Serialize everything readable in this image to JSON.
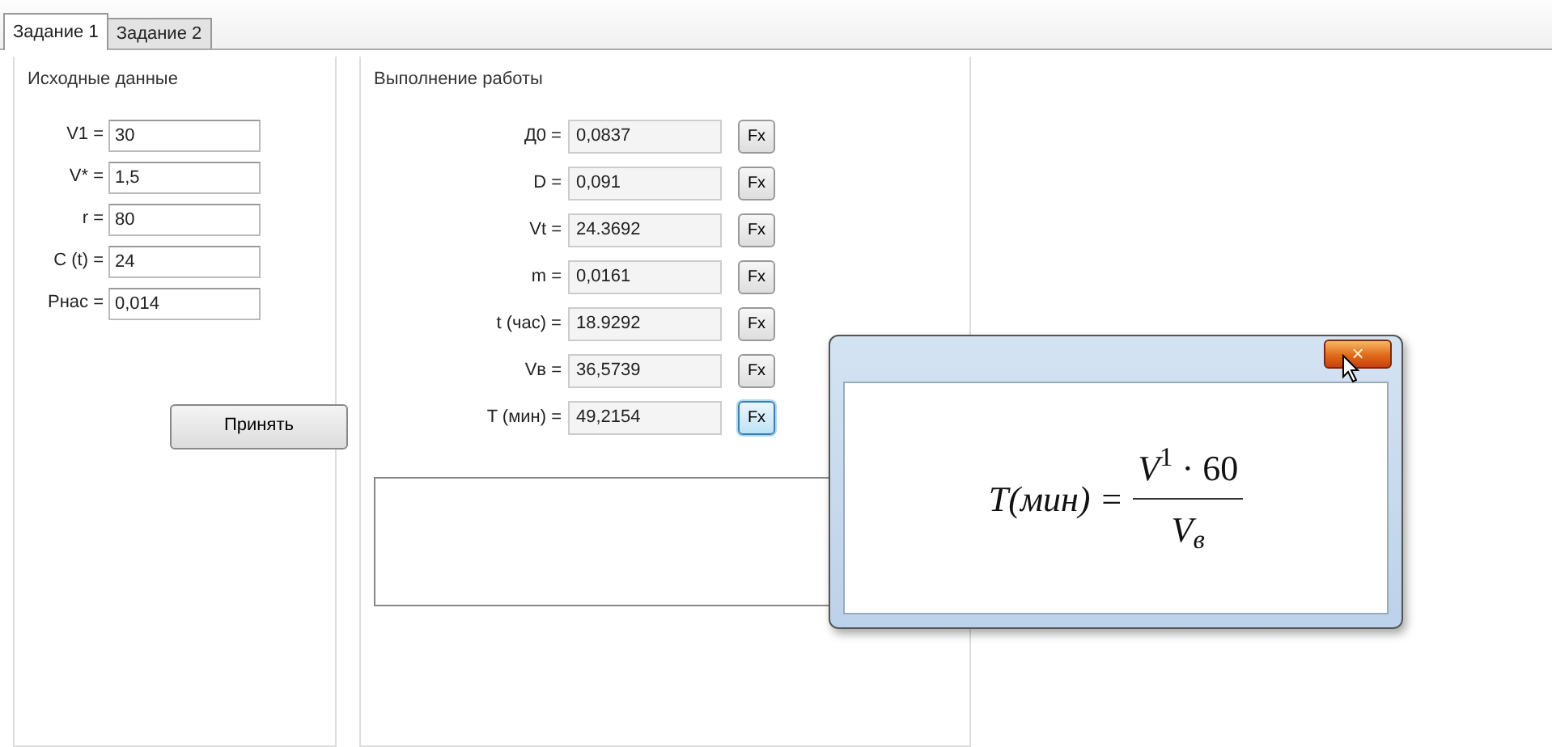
{
  "tabs": [
    {
      "label": "Задание 1",
      "selected": true
    },
    {
      "label": "Задание 2",
      "selected": false
    }
  ],
  "input_group": {
    "title": "Исходные данные",
    "fields": [
      {
        "label": "V1 =",
        "value": "30"
      },
      {
        "label": "V* =",
        "value": "1,5"
      },
      {
        "label": "r =",
        "value": "80"
      },
      {
        "label": "C (t) =",
        "value": "24"
      },
      {
        "label": "Pнас =",
        "value": "0,014"
      }
    ],
    "button": "Принять"
  },
  "work_group": {
    "title": "Выполнение работы",
    "rows": [
      {
        "label": "Д0 =",
        "value": "0,0837",
        "button": "Fx",
        "focused": false
      },
      {
        "label": "D =",
        "value": "0,091",
        "button": "Fx",
        "focused": false
      },
      {
        "label": "Vt =",
        "value": "24.3692",
        "button": "Fx",
        "focused": false
      },
      {
        "label": "m =",
        "value": "0,0161",
        "button": "Fx",
        "focused": false
      },
      {
        "label": "t (час) =",
        "value": "18.9292",
        "button": "Fx",
        "focused": false
      },
      {
        "label": "Vв =",
        "value": "36,5739",
        "button": "Fx",
        "focused": false
      },
      {
        "label": "T (мин) =",
        "value": "49,2154",
        "button": "Fx",
        "focused": true
      }
    ]
  },
  "formula_window": {
    "close": "×",
    "lhs": "T(мин) =",
    "numerator": "*V*$^{1}$ · 60",
    "denominator": "V$_{в}$"
  }
}
